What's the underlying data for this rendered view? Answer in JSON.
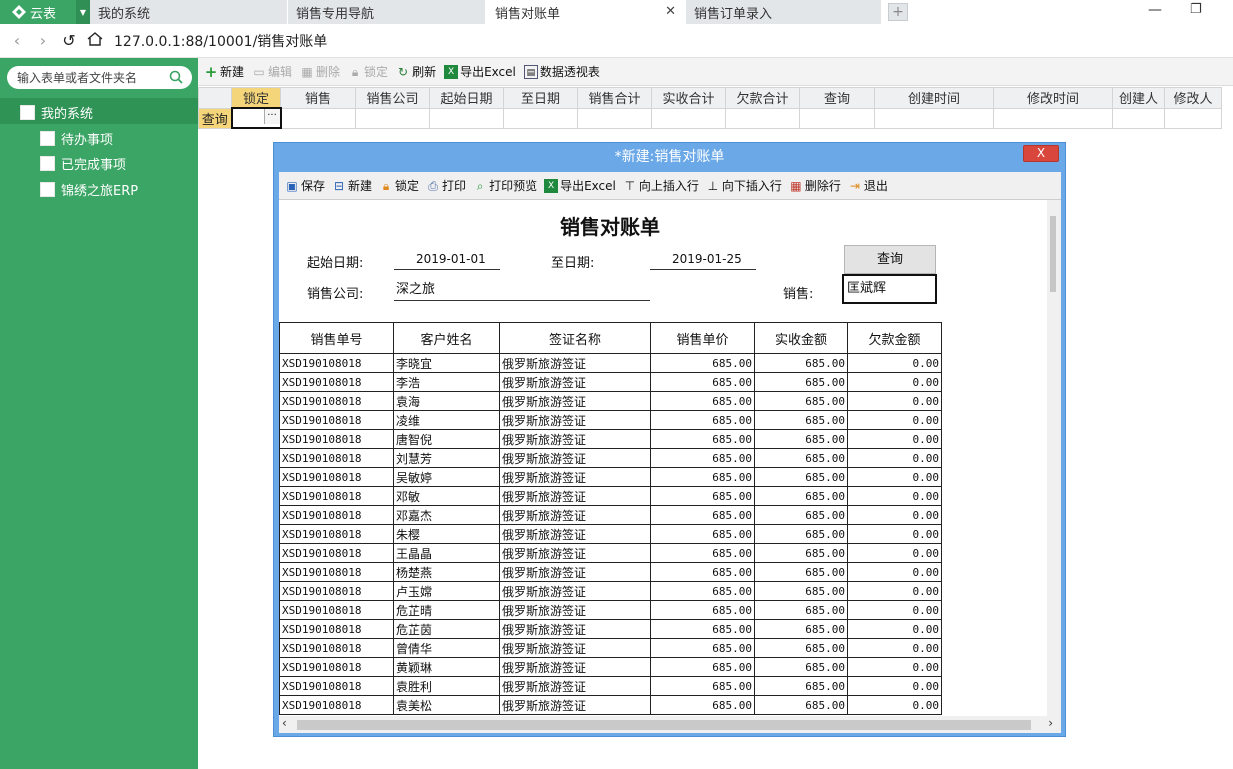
{
  "app": {
    "name": "云表"
  },
  "tabs": [
    {
      "label": "我的系统"
    },
    {
      "label": "销售专用导航"
    },
    {
      "label": "销售对账单",
      "active": true
    },
    {
      "label": "销售订单录入"
    }
  ],
  "address": {
    "url": "127.0.0.1:88/10001/销售对账单"
  },
  "sidebar": {
    "search_placeholder": "输入表单或者文件夹名",
    "items": [
      {
        "label": "我的系统"
      },
      {
        "label": "待办事项"
      },
      {
        "label": "已完成事项"
      },
      {
        "label": "锦绣之旅ERP"
      }
    ]
  },
  "toolbar": {
    "new": "新建",
    "edit": "编辑",
    "delete": "删除",
    "lock": "锁定",
    "refresh": "刷新",
    "export": "导出Excel",
    "pivot": "数据透视表"
  },
  "grid": {
    "row_header": "查询",
    "columns": [
      "锁定",
      "销售",
      "销售公司",
      "起始日期",
      "至日期",
      "销售合计",
      "实收合计",
      "欠款合计",
      "查询",
      "创建时间",
      "修改时间",
      "创建人",
      "修改人"
    ]
  },
  "dialog": {
    "title": "*新建:销售对账单",
    "close": "X",
    "toolbar": {
      "save": "保存",
      "new": "新建",
      "lock": "锁定",
      "print": "打印",
      "preview": "打印预览",
      "export": "导出Excel",
      "insert_up": "向上插入行",
      "insert_down": "向下插入行",
      "delete_row": "删除行",
      "exit": "退出"
    },
    "report": {
      "title": "销售对账单",
      "start_label": "起始日期:",
      "start_value": "2019-01-01",
      "end_label": "至日期:",
      "end_value": "2019-01-25",
      "company_label": "销售公司:",
      "company_value": "深之旅",
      "sales_label": "销售:",
      "sales_value": "匡斌辉",
      "query_button": "查询",
      "columns": [
        "销售单号",
        "客户姓名",
        "签证名称",
        "销售单价",
        "实收金额",
        "欠款金额"
      ],
      "rows": [
        [
          "XSD190108018",
          "李晓宜",
          "俄罗斯旅游签证",
          "685.00",
          "685.00",
          "0.00"
        ],
        [
          "XSD190108018",
          "李浩",
          "俄罗斯旅游签证",
          "685.00",
          "685.00",
          "0.00"
        ],
        [
          "XSD190108018",
          "袁海",
          "俄罗斯旅游签证",
          "685.00",
          "685.00",
          "0.00"
        ],
        [
          "XSD190108018",
          "凌维",
          "俄罗斯旅游签证",
          "685.00",
          "685.00",
          "0.00"
        ],
        [
          "XSD190108018",
          "唐智倪",
          "俄罗斯旅游签证",
          "685.00",
          "685.00",
          "0.00"
        ],
        [
          "XSD190108018",
          "刘慧芳",
          "俄罗斯旅游签证",
          "685.00",
          "685.00",
          "0.00"
        ],
        [
          "XSD190108018",
          "吴敏婷",
          "俄罗斯旅游签证",
          "685.00",
          "685.00",
          "0.00"
        ],
        [
          "XSD190108018",
          "邓敏",
          "俄罗斯旅游签证",
          "685.00",
          "685.00",
          "0.00"
        ],
        [
          "XSD190108018",
          "邓嘉杰",
          "俄罗斯旅游签证",
          "685.00",
          "685.00",
          "0.00"
        ],
        [
          "XSD190108018",
          "朱樱",
          "俄罗斯旅游签证",
          "685.00",
          "685.00",
          "0.00"
        ],
        [
          "XSD190108018",
          "王晶晶",
          "俄罗斯旅游签证",
          "685.00",
          "685.00",
          "0.00"
        ],
        [
          "XSD190108018",
          "杨楚燕",
          "俄罗斯旅游签证",
          "685.00",
          "685.00",
          "0.00"
        ],
        [
          "XSD190108018",
          "卢玉嫦",
          "俄罗斯旅游签证",
          "685.00",
          "685.00",
          "0.00"
        ],
        [
          "XSD190108018",
          "危芷晴",
          "俄罗斯旅游签证",
          "685.00",
          "685.00",
          "0.00"
        ],
        [
          "XSD190108018",
          "危芷茵",
          "俄罗斯旅游签证",
          "685.00",
          "685.00",
          "0.00"
        ],
        [
          "XSD190108018",
          "曾倩华",
          "俄罗斯旅游签证",
          "685.00",
          "685.00",
          "0.00"
        ],
        [
          "XSD190108018",
          "黄颖琳",
          "俄罗斯旅游签证",
          "685.00",
          "685.00",
          "0.00"
        ],
        [
          "XSD190108018",
          "袁胜利",
          "俄罗斯旅游签证",
          "685.00",
          "685.00",
          "0.00"
        ],
        [
          "XSD190108018",
          "袁美松",
          "俄罗斯旅游签证",
          "685.00",
          "685.00",
          "0.00"
        ]
      ]
    }
  },
  "colors": {
    "sidebar_green": "#3aa564",
    "dialog_blue": "#6aa8e8",
    "locked_yellow": "#f4d57a",
    "close_red": "#d9473c"
  }
}
